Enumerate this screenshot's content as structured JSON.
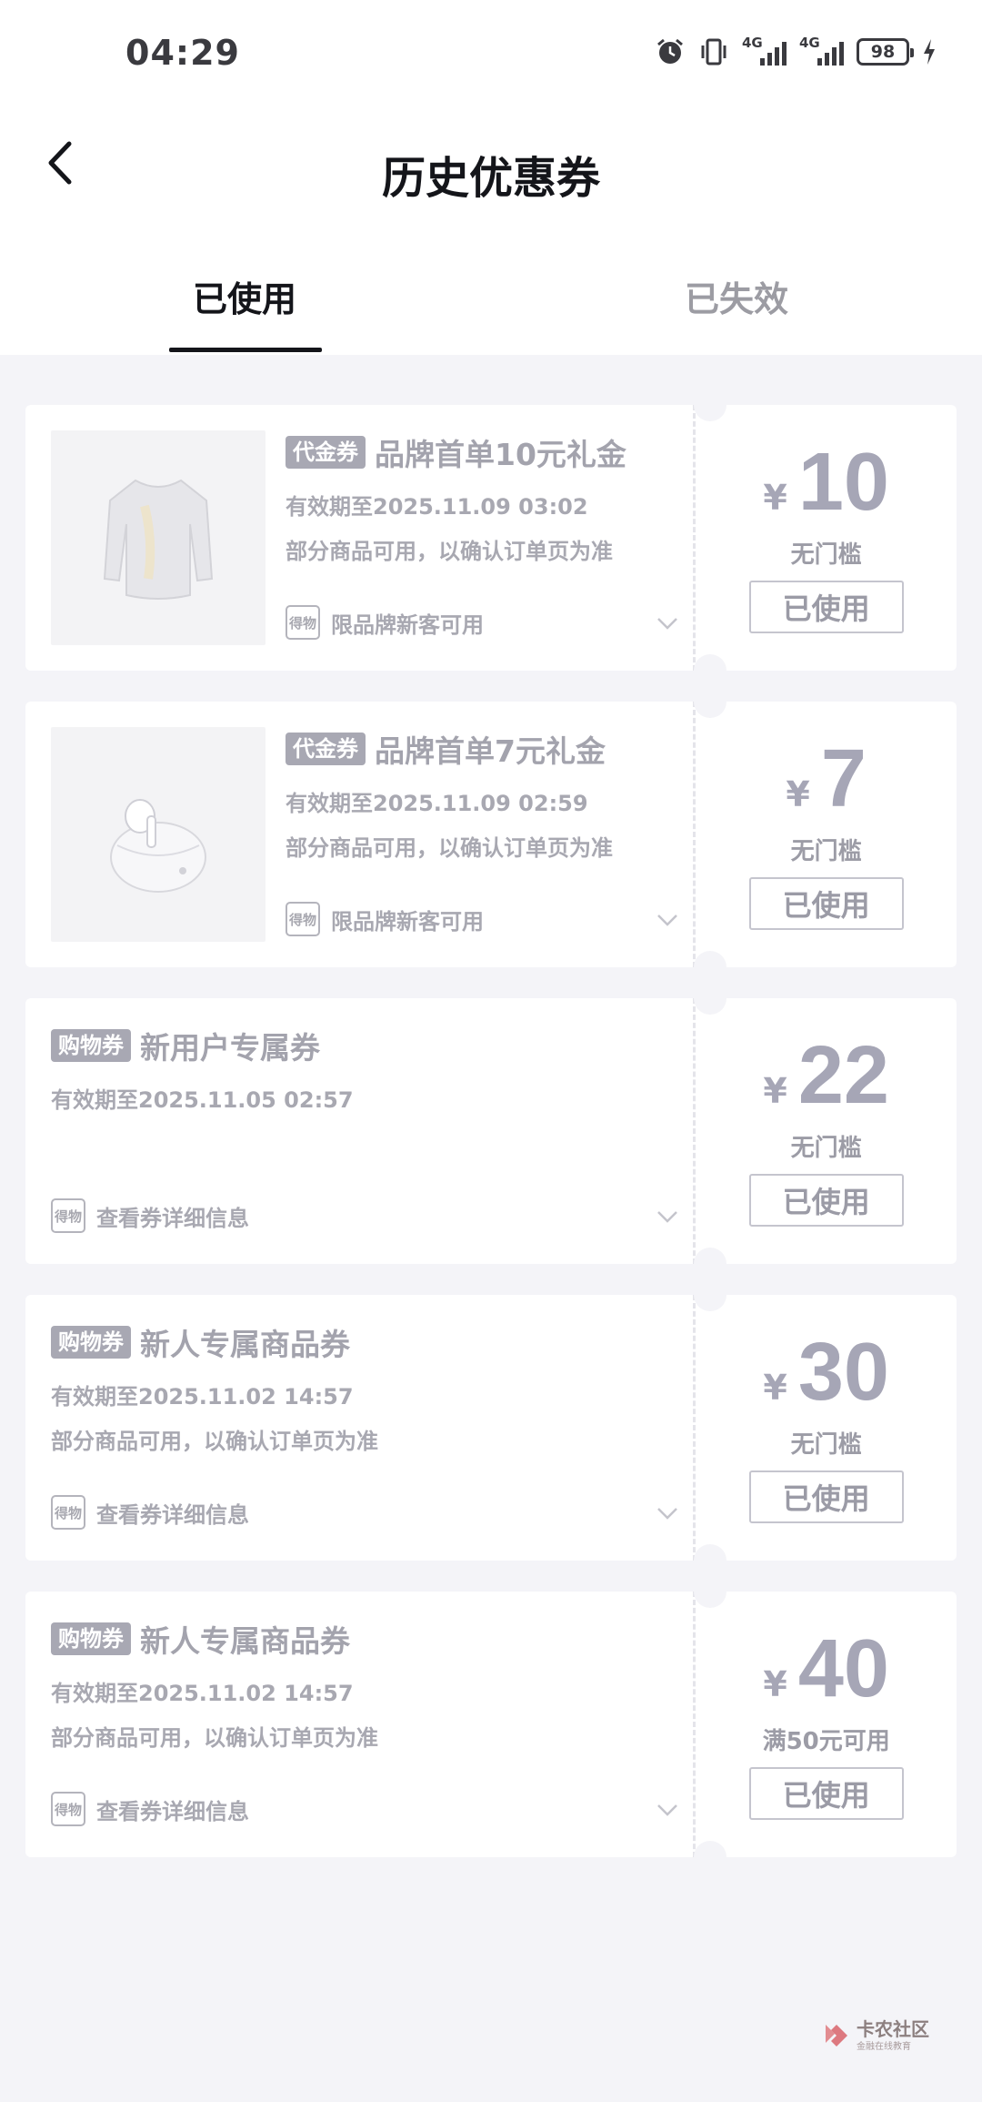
{
  "status_bar": {
    "time": "04:29",
    "network1": "4G",
    "network2": "4G",
    "battery": "98"
  },
  "header": {
    "title": "历史优惠券"
  },
  "tabs": [
    {
      "label": "已使用",
      "active": true
    },
    {
      "label": "已失效",
      "active": false
    }
  ],
  "coupons": [
    {
      "has_image": true,
      "image_icon": "sweatshirt-icon",
      "tag": "代金券",
      "title": "品牌首单10元礼金",
      "validity": "有效期至2025.11.09 03:02",
      "note": "部分商品可用，以确认订单页为准",
      "bottom_text": "限品牌新客可用",
      "currency": "¥",
      "amount": "10",
      "condition": "无门槛",
      "status": "已使用"
    },
    {
      "has_image": true,
      "image_icon": "earbuds-icon",
      "tag": "代金券",
      "title": "品牌首单7元礼金",
      "validity": "有效期至2025.11.09 02:59",
      "note": "部分商品可用，以确认订单页为准",
      "bottom_text": "限品牌新客可用",
      "currency": "¥",
      "amount": "7",
      "condition": "无门槛",
      "status": "已使用"
    },
    {
      "has_image": false,
      "tag": "购物券",
      "title": "新用户专属券",
      "validity": "有效期至2025.11.05 02:57",
      "note": "",
      "bottom_text": "查看券详细信息",
      "currency": "¥",
      "amount": "22",
      "condition": "无门槛",
      "status": "已使用"
    },
    {
      "has_image": false,
      "tag": "购物券",
      "title": "新人专属商品券",
      "validity": "有效期至2025.11.02 14:57",
      "note": "部分商品可用，以确认订单页为准",
      "bottom_text": "查看券详细信息",
      "currency": "¥",
      "amount": "30",
      "condition": "无门槛",
      "status": "已使用"
    },
    {
      "has_image": false,
      "tag": "购物券",
      "title": "新人专属商品券",
      "validity": "有效期至2025.11.02 14:57",
      "note": "部分商品可用，以确认订单页为准",
      "bottom_text": "查看券详细信息",
      "currency": "¥",
      "amount": "40",
      "condition": "满50元可用",
      "status": "已使用"
    }
  ],
  "brand_badge_text": "得物",
  "watermark": {
    "name": "卡农社区",
    "sub": "金融在线教育"
  },
  "colors": {
    "background": "#f4f4f8",
    "card": "#ffffff",
    "muted": "#a6a6b6"
  }
}
